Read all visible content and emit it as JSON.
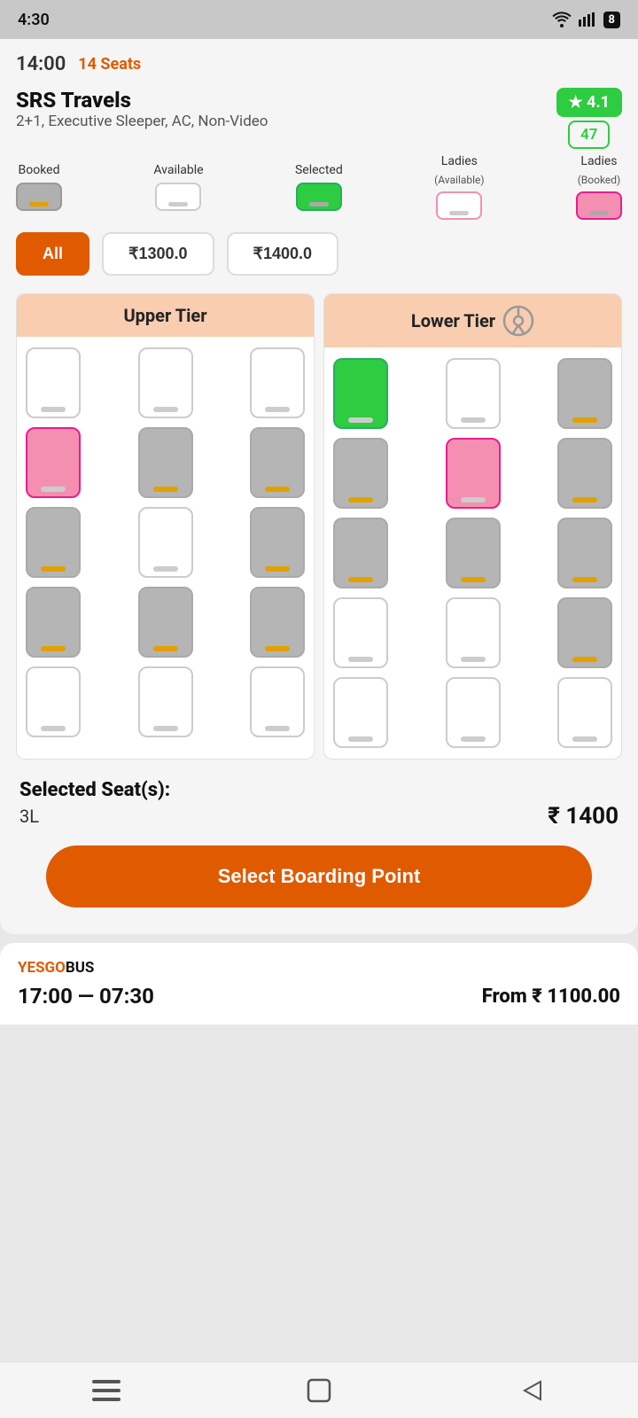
{
  "statusBar": {
    "time": "4:30"
  },
  "header": {
    "departureTime": "14:00",
    "seatsBadge": "14 Seats"
  },
  "operator": {
    "name": "SRS Travels",
    "description": "2+1, Executive Sleeper, AC, Non-Video",
    "ratingValue": "★ 4.1",
    "ratingCount": "47"
  },
  "legend": {
    "items": [
      {
        "type": "booked",
        "label": "Booked"
      },
      {
        "type": "available",
        "label": "Available"
      },
      {
        "type": "selected",
        "label": "Selected"
      },
      {
        "type": "ladies-available",
        "label": "Ladies",
        "sublabel": "(Available)"
      },
      {
        "type": "ladies-booked",
        "label": "Ladies",
        "sublabel": "(Booked)"
      }
    ]
  },
  "priceFilter": {
    "allLabel": "All",
    "price1": "₹1300.0",
    "price2": "₹1400.0"
  },
  "seatMap": {
    "upperTier": {
      "title": "Upper Tier"
    },
    "lowerTier": {
      "title": "Lower Tier"
    }
  },
  "selectedSeats": {
    "title": "Selected Seat(s):",
    "seatNumber": "3L",
    "price": "₹ 1400"
  },
  "boardingBtn": {
    "label": "Select Boarding Point"
  },
  "bottomCard": {
    "brandOrange": "YESGO",
    "brandBlack": "BUS",
    "timeRange": "17:00 — 07:30",
    "fromLabel": "From",
    "price": "₹ 1100.00"
  },
  "navBar": {
    "menuIcon": "≡",
    "homeIcon": "□",
    "backIcon": "◁"
  }
}
